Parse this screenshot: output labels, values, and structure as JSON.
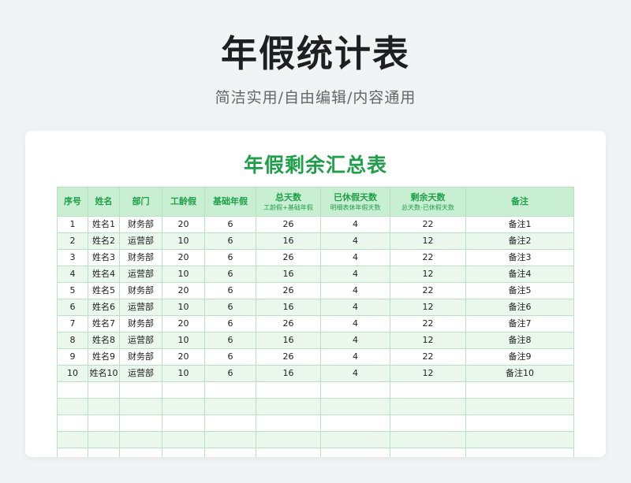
{
  "page": {
    "title": "年假统计表",
    "subtitle": "简洁实用/自由编辑/内容通用"
  },
  "sheet": {
    "title": "年假剩余汇总表",
    "columns": [
      {
        "label": "序号",
        "sub": ""
      },
      {
        "label": "姓名",
        "sub": ""
      },
      {
        "label": "部门",
        "sub": ""
      },
      {
        "label": "工龄假",
        "sub": ""
      },
      {
        "label": "基础年假",
        "sub": ""
      },
      {
        "label": "总天数",
        "sub": "工龄假+基础年假"
      },
      {
        "label": "已休假天数",
        "sub": "明细表休年假天数"
      },
      {
        "label": "剩余天数",
        "sub": "总天数-已休假天数"
      },
      {
        "label": "备注",
        "sub": ""
      }
    ],
    "rows": [
      [
        "1",
        "姓名1",
        "财务部",
        "20",
        "6",
        "26",
        "4",
        "22",
        "备注1"
      ],
      [
        "2",
        "姓名2",
        "运营部",
        "10",
        "6",
        "16",
        "4",
        "12",
        "备注2"
      ],
      [
        "3",
        "姓名3",
        "财务部",
        "20",
        "6",
        "26",
        "4",
        "22",
        "备注3"
      ],
      [
        "4",
        "姓名4",
        "运营部",
        "10",
        "6",
        "16",
        "4",
        "12",
        "备注4"
      ],
      [
        "5",
        "姓名5",
        "财务部",
        "20",
        "6",
        "26",
        "4",
        "22",
        "备注5"
      ],
      [
        "6",
        "姓名6",
        "运营部",
        "10",
        "6",
        "16",
        "4",
        "12",
        "备注6"
      ],
      [
        "7",
        "姓名7",
        "财务部",
        "20",
        "6",
        "26",
        "4",
        "22",
        "备注7"
      ],
      [
        "8",
        "姓名8",
        "运营部",
        "10",
        "6",
        "16",
        "4",
        "12",
        "备注8"
      ],
      [
        "9",
        "姓名9",
        "财务部",
        "20",
        "6",
        "26",
        "4",
        "22",
        "备注9"
      ],
      [
        "10",
        "姓名10",
        "运营部",
        "10",
        "6",
        "16",
        "4",
        "12",
        "备注10"
      ],
      [
        "",
        "",
        "",
        "",
        "",
        "",
        "",
        "",
        ""
      ],
      [
        "",
        "",
        "",
        "",
        "",
        "",
        "",
        "",
        ""
      ],
      [
        "",
        "",
        "",
        "",
        "",
        "",
        "",
        "",
        ""
      ],
      [
        "",
        "",
        "",
        "",
        "",
        "",
        "",
        "",
        ""
      ],
      [
        "",
        "",
        "",
        "",
        "",
        "",
        "",
        "",
        ""
      ]
    ]
  },
  "colors": {
    "accent_green": "#1f9f49",
    "header_fill": "#c9efd2",
    "stripe_fill": "#e9f7ec",
    "page_background": "#f2f3f5"
  }
}
